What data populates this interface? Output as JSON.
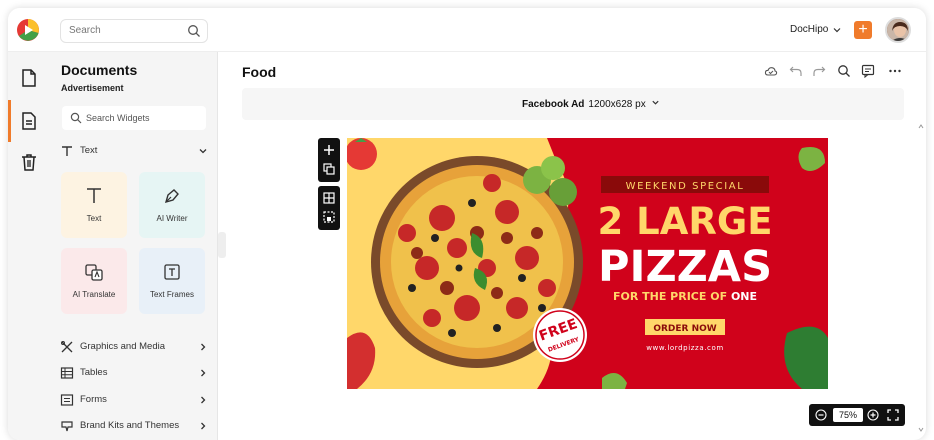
{
  "topbar": {
    "search_placeholder": "Search",
    "brand": "DocHipo",
    "add_label": "+"
  },
  "panel": {
    "title": "Documents",
    "subtitle": "Advertisement",
    "search_placeholder": "Search Widgets",
    "text_section": "Text",
    "tiles": [
      {
        "label": "Text",
        "color": "#fdf3e2",
        "icon": "text-t-icon"
      },
      {
        "label": "AI Writer",
        "color": "#e6f5f4",
        "icon": "pen-nib-icon"
      },
      {
        "label": "AI Translate",
        "color": "#fbe9ea",
        "icon": "translate-icon"
      },
      {
        "label": "Text Frames",
        "color": "#e8f0f8",
        "icon": "text-frame-icon"
      }
    ],
    "sections": [
      {
        "label": "Graphics and Media",
        "icon": "graphics-media-icon"
      },
      {
        "label": "Tables",
        "icon": "table-icon"
      },
      {
        "label": "Forms",
        "icon": "form-icon"
      },
      {
        "label": "Brand Kits and Themes",
        "icon": "brand-kit-icon"
      }
    ]
  },
  "editor": {
    "doc_title": "Food",
    "format_name": "Facebook Ad",
    "format_size": "1200x628 px",
    "zoom": "75%"
  },
  "ad": {
    "banner": "WEEKEND SPECIAL",
    "line1": "2 LARGE",
    "line2": "PIZZAS",
    "line3_prefix": "FOR THE PRICE OF",
    "line3_emph": "ONE",
    "cta": "ORDER NOW",
    "url": "www.lordpizza.com",
    "badge_top": "FREE",
    "badge_bottom": "DELIVERY",
    "colors": {
      "red": "#d0021b",
      "yellow": "#ffd76a",
      "accent": "#f07b2b"
    }
  }
}
